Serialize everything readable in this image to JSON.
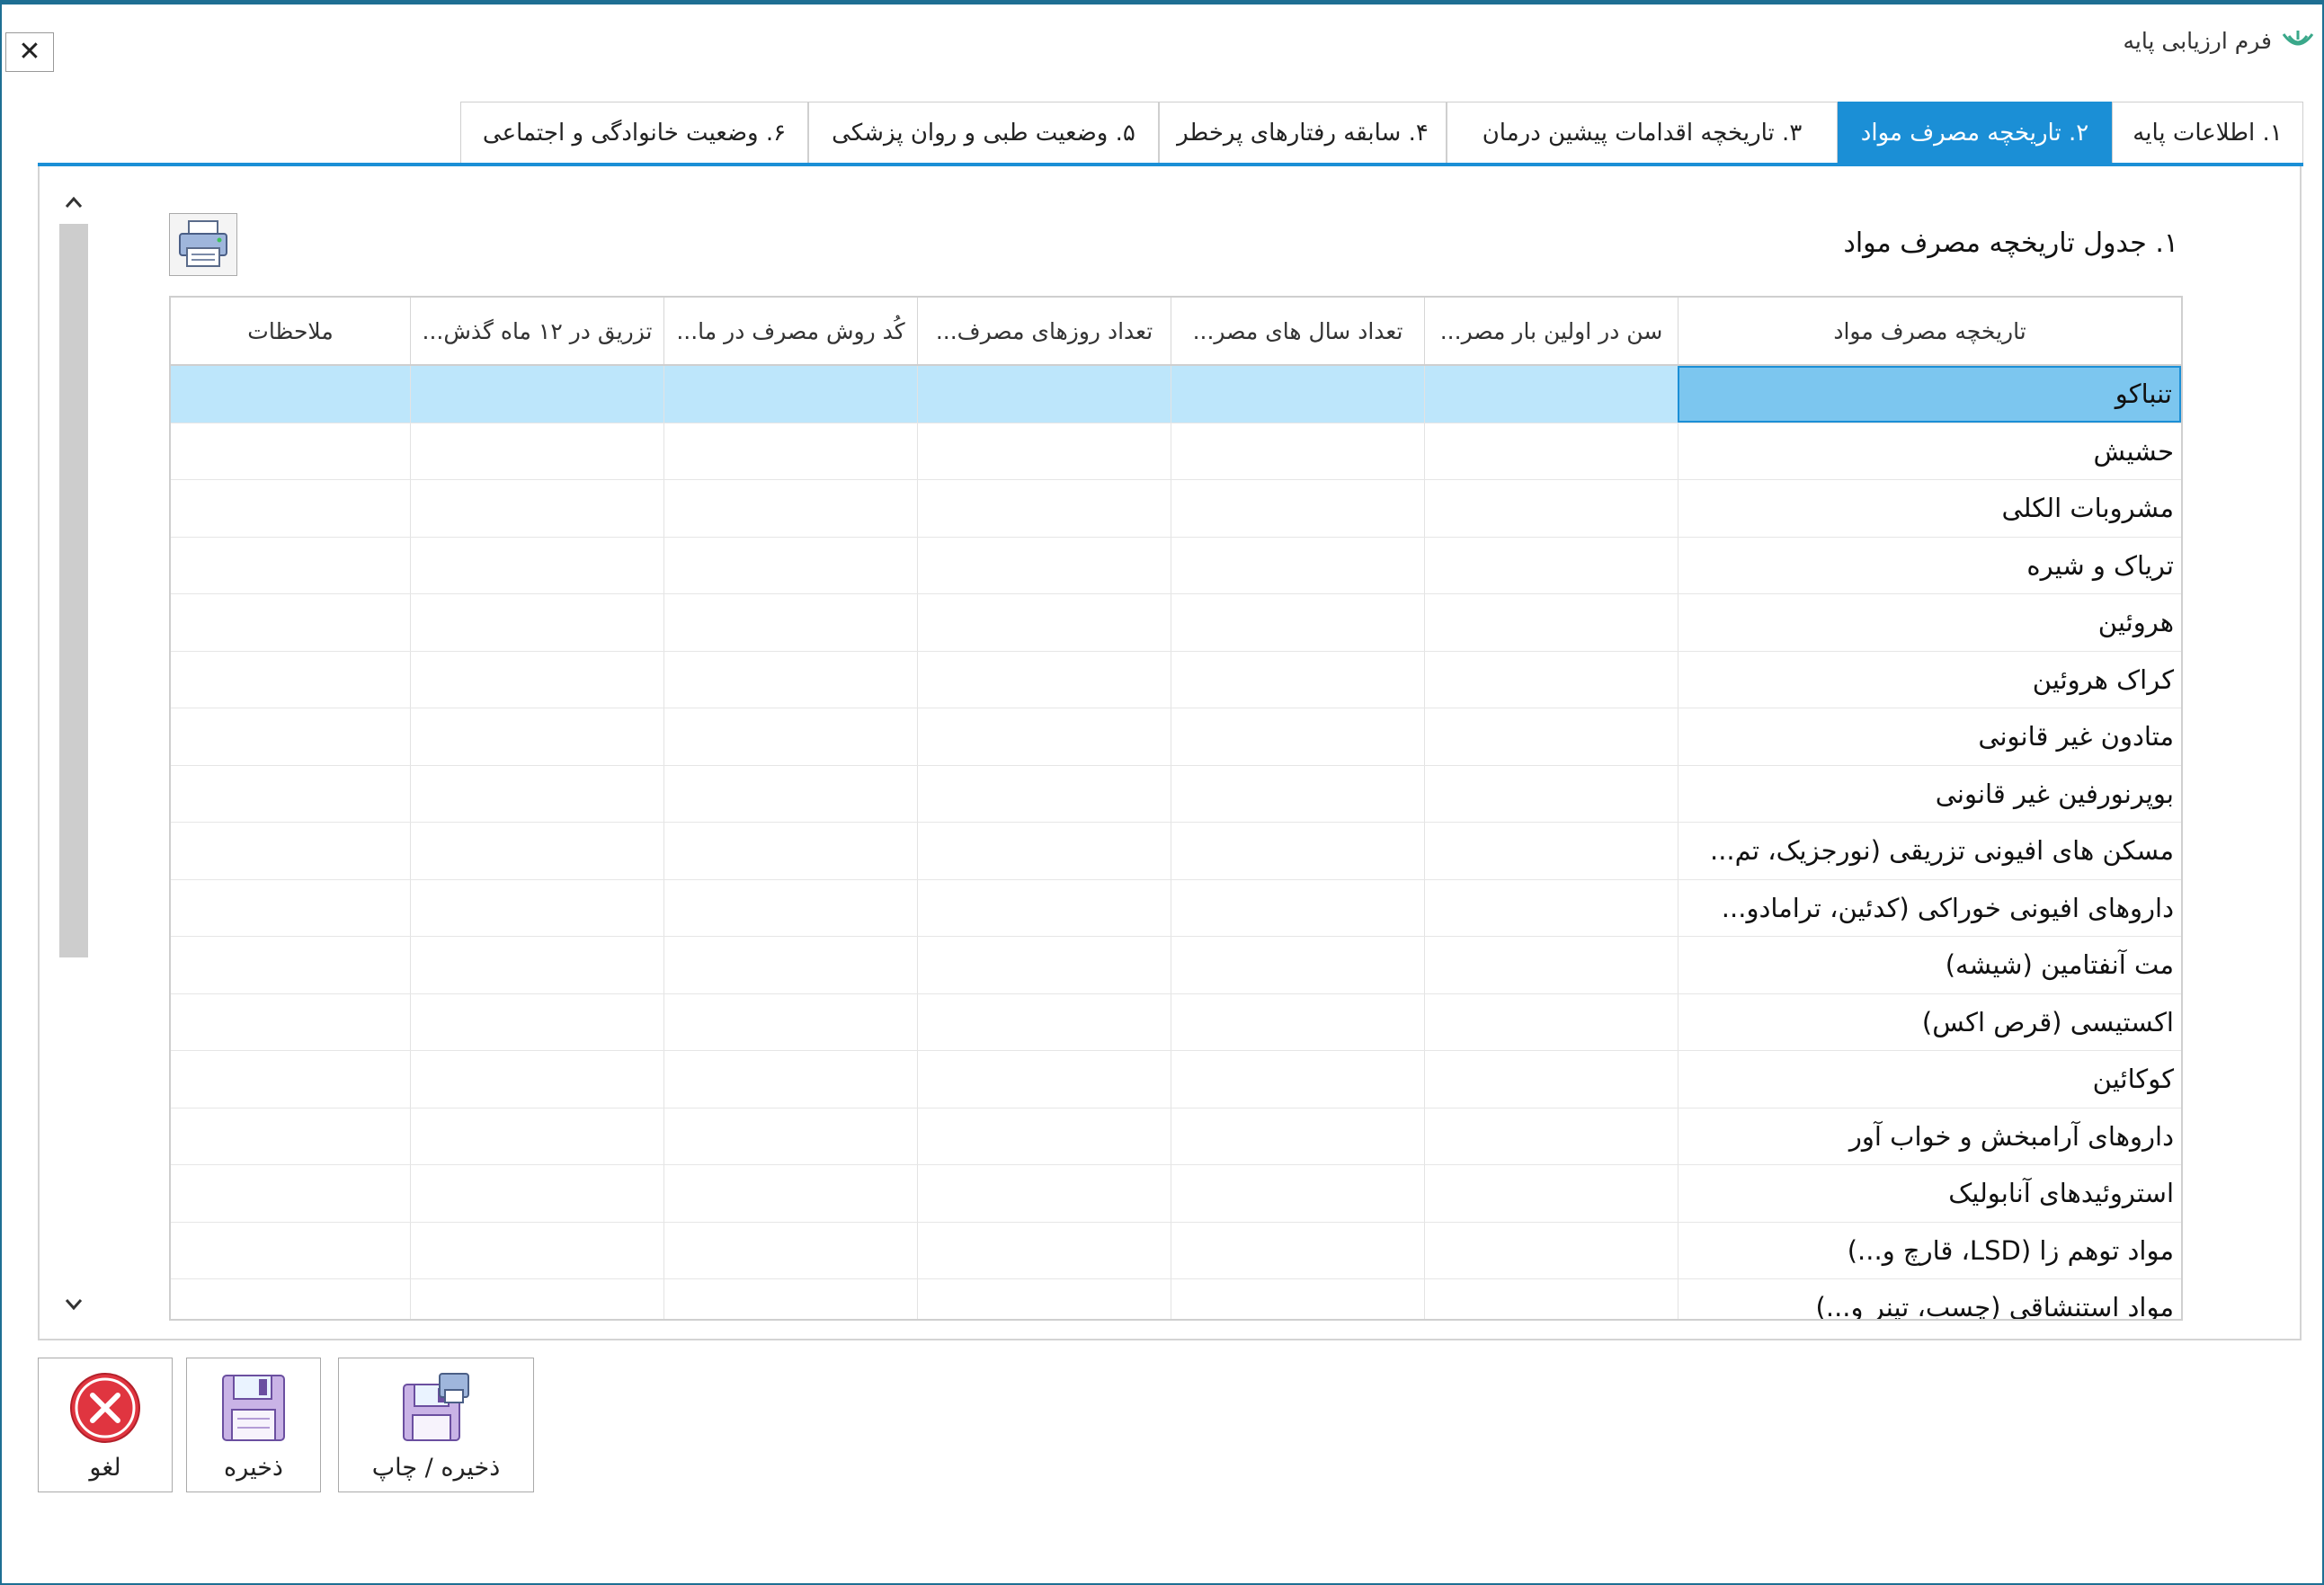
{
  "window": {
    "title": "فرم ارزیابی پایه",
    "close_label": "✕"
  },
  "tabs": [
    {
      "label": "۱. اطلاعات پایه",
      "active": false
    },
    {
      "label": "۲. تاریخچه مصرف مواد",
      "active": true
    },
    {
      "label": "۳. تاریخچه اقدامات پیشین درمان",
      "active": false
    },
    {
      "label": "۴. سابقه رفتارهای پرخطر",
      "active": false
    },
    {
      "label": "۵. وضعیت طبی و روان پزشکی",
      "active": false
    },
    {
      "label": "۶. وضعیت خانوادگی و اجتماعی",
      "active": false
    }
  ],
  "section": {
    "title": "۱. جدول تاریخچه مصرف مواد"
  },
  "table": {
    "columns": [
      "تاریخچه مصرف مواد",
      "سن در اولین بار مصر...",
      "تعداد سال های مصر...",
      "تعداد روزهای مصرف...",
      "کُد روش مصرف در ما...",
      "تزریق در ۱۲ ماه گذش...",
      "ملاحظات"
    ],
    "rows": [
      "تنباکو",
      "حشیش",
      "مشروبات الکلی",
      "تریاک و شیره",
      "هروئین",
      "کراک هروئین",
      "متادون غیر قانونی",
      "بوپرنورفین غیر قانونی",
      "مسکن های افیونی تزریقی (نورجزیک، تم...",
      "داروهای افیونی خوراکی (کدئین، ترامادو...",
      "مت آنفتامین (شیشه)",
      "اکستیسی (قرص اکس)",
      "کوکائین",
      "داروهای آرامبخش و خواب آور",
      "استروئیدهای آنابولیک",
      "مواد توهم زا (LSD، قارچ و...)",
      "مواد استنشاقی (چسب، تینر و...)"
    ],
    "selected_row": 0
  },
  "actions": {
    "cancel_label": "لغو",
    "save_label": "ذخیره",
    "save_print_label": "ذخیره / چاپ"
  },
  "colors": {
    "accent": "#1b8fd6",
    "selected_row": "#bde6fb",
    "selected_cell": "#7cc6ef",
    "cancel_red": "#e03540"
  }
}
